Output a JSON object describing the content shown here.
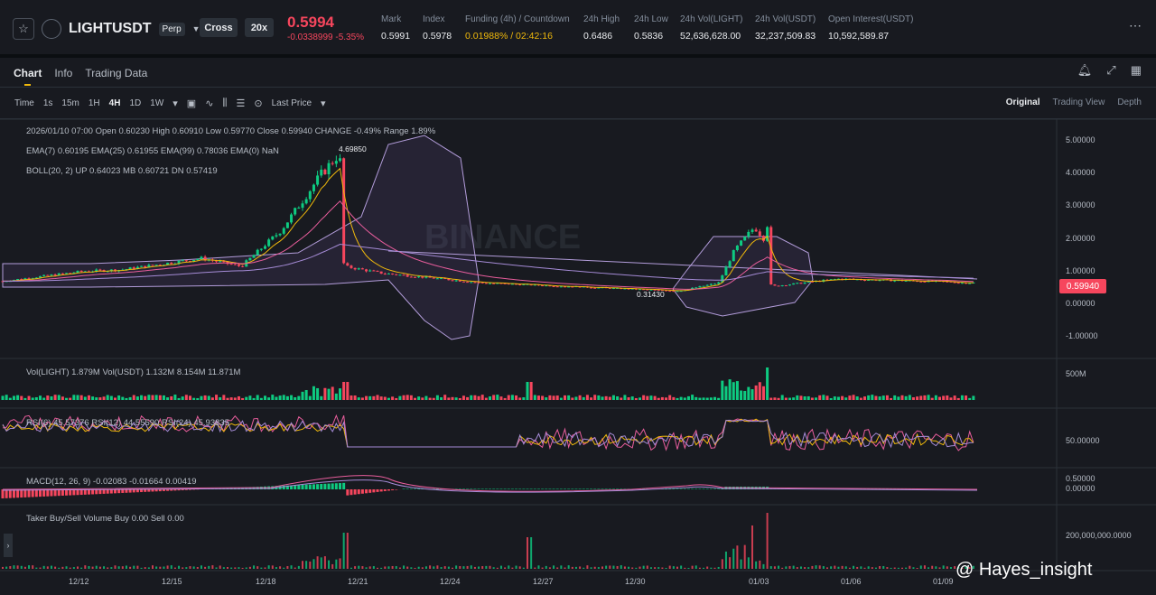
{
  "header": {
    "symbol": "LIGHTUSDT",
    "contract": "Perp",
    "margin_mode": "Cross",
    "leverage": "20x",
    "last_price": "0.5994",
    "change": "-0.0338999 -5.35%",
    "stats": [
      {
        "label": "Mark",
        "value": "0.5991"
      },
      {
        "label": "Index",
        "value": "0.5978"
      },
      {
        "label": "Funding (4h) / Countdown",
        "value": "0.01988% / 02:42:16"
      },
      {
        "label": "24h High",
        "value": "0.6486"
      },
      {
        "label": "24h Low",
        "value": "0.5836"
      },
      {
        "label": "24h Vol(LIGHT)",
        "value": "52,636,628.00"
      },
      {
        "label": "24h Vol(USDT)",
        "value": "32,237,509.83"
      },
      {
        "label": "Open Interest(USDT)",
        "value": "10,592,589.87"
      }
    ]
  },
  "tabs": [
    "Chart",
    "Info",
    "Trading Data"
  ],
  "timeframes": [
    "Time",
    "1s",
    "15m",
    "1H",
    "4H",
    "1D",
    "1W"
  ],
  "active_timeframe": "4H",
  "price_type": "Last Price",
  "views": [
    "Original",
    "Trading View",
    "Depth"
  ],
  "legend": {
    "ohlc": "2026/01/10 07:00  Open 0.60230  High 0.60910  Low 0.59770  Close 0.59940  CHANGE -0.49%  Range 1.89%",
    "ema": "EMA(7) 0.60195  EMA(25) 0.61955  EMA(99) 0.78036  EMA(0) NaN",
    "boll": "BOLL(20, 2)  UP 0.64023  MB 0.60721  DN 0.57419",
    "vol": "Vol(LIGHT)  1.879M  Vol(USDT)  1.132M  8.154M  11.871M",
    "rsi": "RSI(6)  45.57376  RSI(12)  44.55590  RSI(24)  45.93835",
    "macd": "MACD(12, 26, 9)  -0.02083  -0.01664  0.00419",
    "taker": "Taker Buy/Sell Volume  Buy 0.00  Sell 0.00"
  },
  "price_axis": [
    "5.00000",
    "4.00000",
    "3.00000",
    "2.00000",
    "1.00000",
    "0.00000",
    "-1.00000"
  ],
  "vol_axis": "500M",
  "rsi_axis": "50.00000",
  "macd_axis": [
    "0.50000",
    "0.00000"
  ],
  "taker_axis": "200,000,000.0000",
  "current_price_tag": "0.59940",
  "high_marker": "4.69850",
  "low_marker": "0.31430",
  "x_ticks": [
    "12/12",
    "12/15",
    "12/18",
    "12/21",
    "12/24",
    "12/27",
    "12/30",
    "01/03",
    "01/06",
    "01/09"
  ],
  "watermark_brand": "BINANCE",
  "watermark": "@ Hayes_insight",
  "colors": {
    "up": "#0ecb81",
    "down": "#f6465d",
    "accent": "#f0b90b"
  }
}
